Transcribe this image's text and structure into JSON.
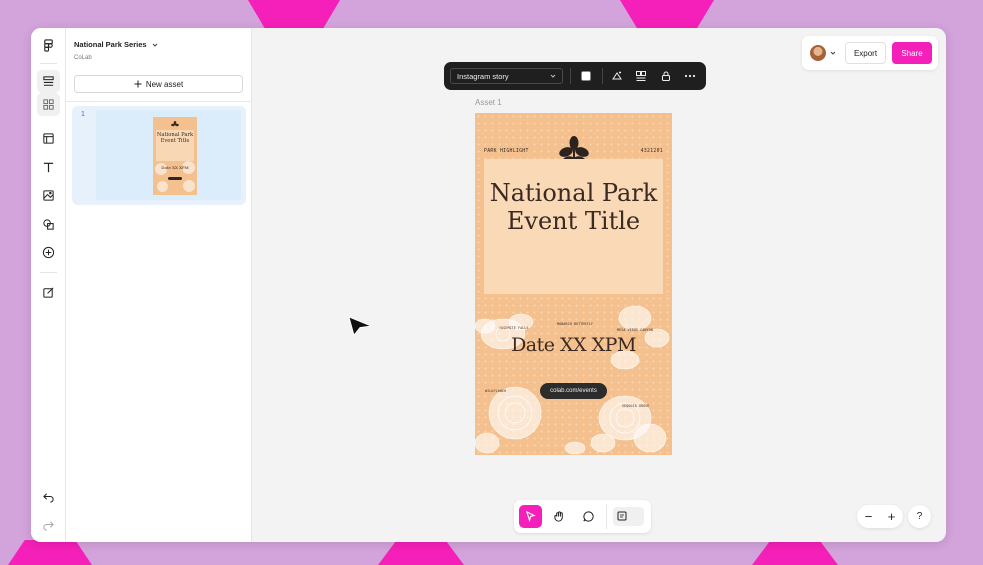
{
  "project": {
    "title": "National Park Series",
    "subtitle": "CoLab"
  },
  "panel": {
    "new_asset_label": "New asset",
    "assets": [
      {
        "number": "1"
      }
    ]
  },
  "toolbar": {
    "format_select": "Instagram story"
  },
  "canvas": {
    "asset_label": "Asset 1"
  },
  "poster": {
    "top_left": "PARK HIGHLIGHT",
    "top_right": "4321201",
    "title": "National Park Event Title",
    "date": "Date XX XPM",
    "url": "colab.com/events",
    "tag_1": "YOSEMITE FALLS",
    "tag_2": "MONARCH BUTTERFLY",
    "tag_3": "MESA VERDE CANYON",
    "tag_4": "WILDFLOWER",
    "tag_5": "SEQUOIA GROVE"
  },
  "header": {
    "export_label": "Export",
    "share_label": "Share"
  },
  "zoom": {
    "minus": "−",
    "plus": "+"
  },
  "help": {
    "label": "?"
  },
  "colors": {
    "accent": "#f51fb9",
    "background": "#d3a3db",
    "poster_bg": "#f4c08e",
    "selection": "#e6f1fc"
  }
}
